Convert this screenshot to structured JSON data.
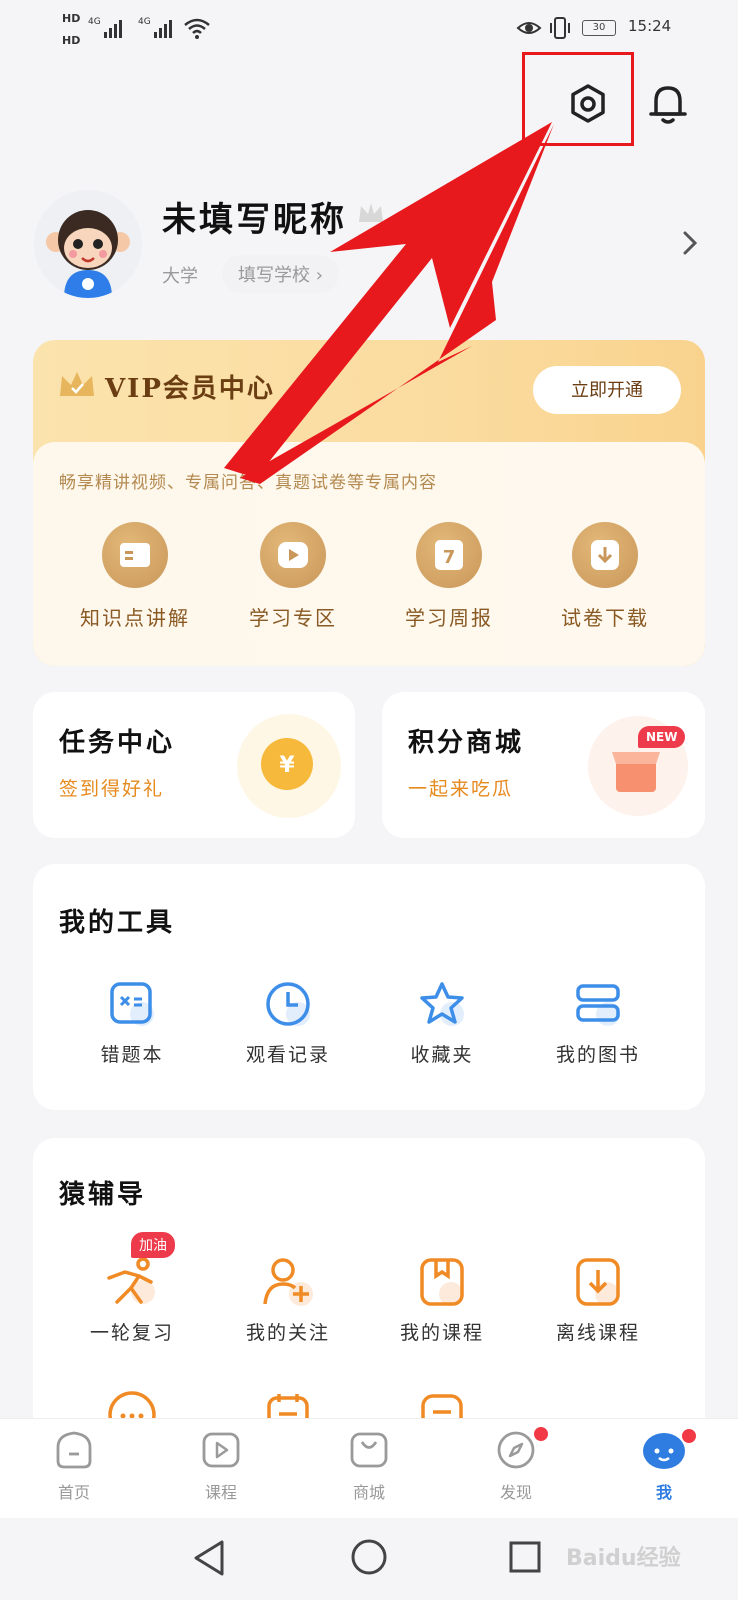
{
  "status_bar": {
    "hd1": "HD",
    "hd2": "HD",
    "net1": "4G",
    "net2": "4G",
    "battery": "30",
    "time": "15:24"
  },
  "profile": {
    "nickname": "未填写昵称",
    "level": "大学",
    "school_chip": "填写学校 ›"
  },
  "vip": {
    "title": "VIP会员中心",
    "button": "立即开通",
    "description": "畅享精讲视频、专属问答、真题试卷等专属内容",
    "features": [
      {
        "label": "知识点讲解",
        "icon": "book-icon"
      },
      {
        "label": "学习专区",
        "icon": "play-icon"
      },
      {
        "label": "学习周报",
        "icon": "calendar-7-icon"
      },
      {
        "label": "试卷下载",
        "icon": "download-icon"
      }
    ]
  },
  "task_center": {
    "title": "任务中心",
    "subtitle": "签到得好礼",
    "icon": "yuan-coin-icon",
    "coin_symbol": "¥"
  },
  "points_mall": {
    "title": "积分商城",
    "subtitle": "一起来吃瓜",
    "badge": "NEW",
    "icon": "shop-icon"
  },
  "my_tools": {
    "title": "我的工具",
    "items": [
      {
        "label": "错题本",
        "icon": "wrong-questions-icon"
      },
      {
        "label": "观看记录",
        "icon": "clock-icon"
      },
      {
        "label": "收藏夹",
        "icon": "star-icon"
      },
      {
        "label": "我的图书",
        "icon": "books-icon"
      }
    ]
  },
  "tutoring": {
    "title": "猿辅导",
    "badge": "加油",
    "items": [
      {
        "label": "一轮复习",
        "icon": "running-icon"
      },
      {
        "label": "我的关注",
        "icon": "add-user-icon"
      },
      {
        "label": "我的课程",
        "icon": "course-box-icon"
      },
      {
        "label": "离线课程",
        "icon": "offline-download-icon"
      }
    ]
  },
  "tab_bar": {
    "items": [
      {
        "label": "首页",
        "icon": "home-icon"
      },
      {
        "label": "课程",
        "icon": "course-icon"
      },
      {
        "label": "商城",
        "icon": "mall-icon"
      },
      {
        "label": "发现",
        "icon": "compass-icon"
      },
      {
        "label": "我",
        "icon": "me-icon"
      }
    ]
  },
  "colors": {
    "accent": "#2f7de1",
    "orange": "#f08a24",
    "annotation_red": "#e8191d"
  },
  "watermark": "Baidu经验"
}
